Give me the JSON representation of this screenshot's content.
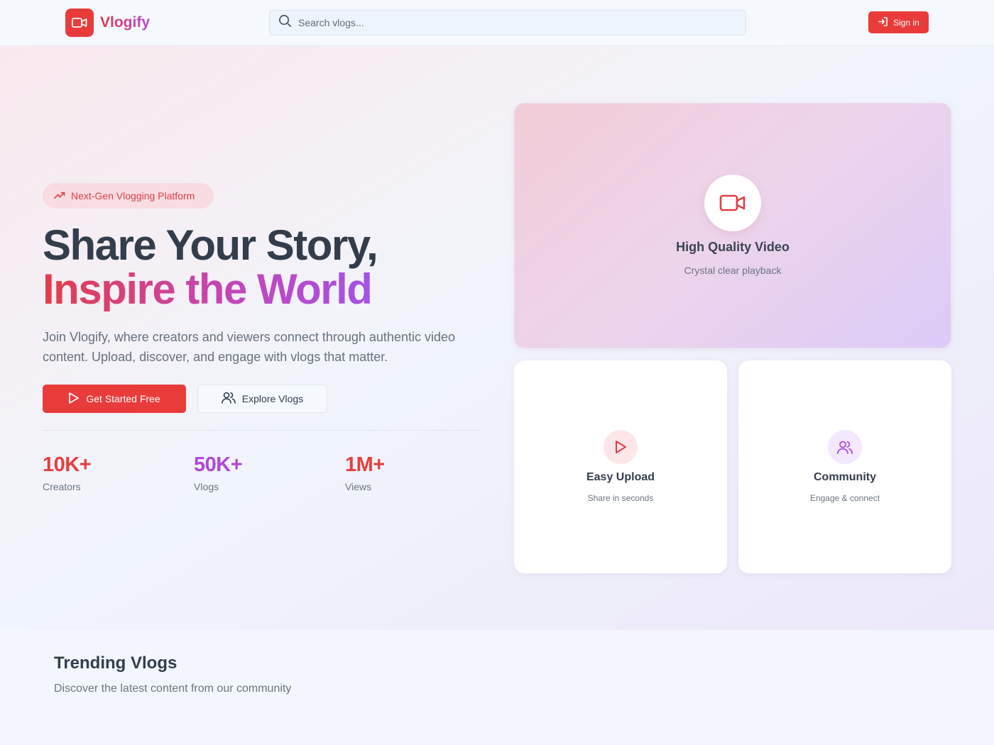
{
  "header": {
    "brand": "Vlogify",
    "search_placeholder": "Search vlogs...",
    "sign_in_label": "Sign in"
  },
  "hero": {
    "badge": "Next-Gen Vlogging Platform",
    "headline_line1": "Share Your Story,",
    "headline_line2": "Inspire the World",
    "description": "Join Vlogify, where creators and viewers connect through authentic video content. Upload, discover, and engage with vlogs that matter.",
    "primary_cta": "Get Started Free",
    "secondary_cta": "Explore Vlogs",
    "stats": [
      {
        "value": "10K+",
        "label": "Creators",
        "color": "#e53e3e"
      },
      {
        "value": "50K+",
        "label": "Vlogs",
        "color": "#b046d8"
      },
      {
        "value": "1M+",
        "label": "Views",
        "color": "#e53e3e"
      }
    ]
  },
  "features": {
    "main": {
      "title": "High Quality Video",
      "subtitle": "Crystal clear playback",
      "icon": "video-camera-icon"
    },
    "upload": {
      "title": "Easy Upload",
      "subtitle": "Share in seconds",
      "icon": "play-icon"
    },
    "community": {
      "title": "Community",
      "subtitle": "Engage & connect",
      "icon": "users-icon"
    }
  },
  "trending": {
    "title": "Trending Vlogs",
    "subtitle": "Discover the latest content from our community"
  },
  "colors": {
    "accent": "#ea3b3b",
    "purple": "#b046d8"
  }
}
